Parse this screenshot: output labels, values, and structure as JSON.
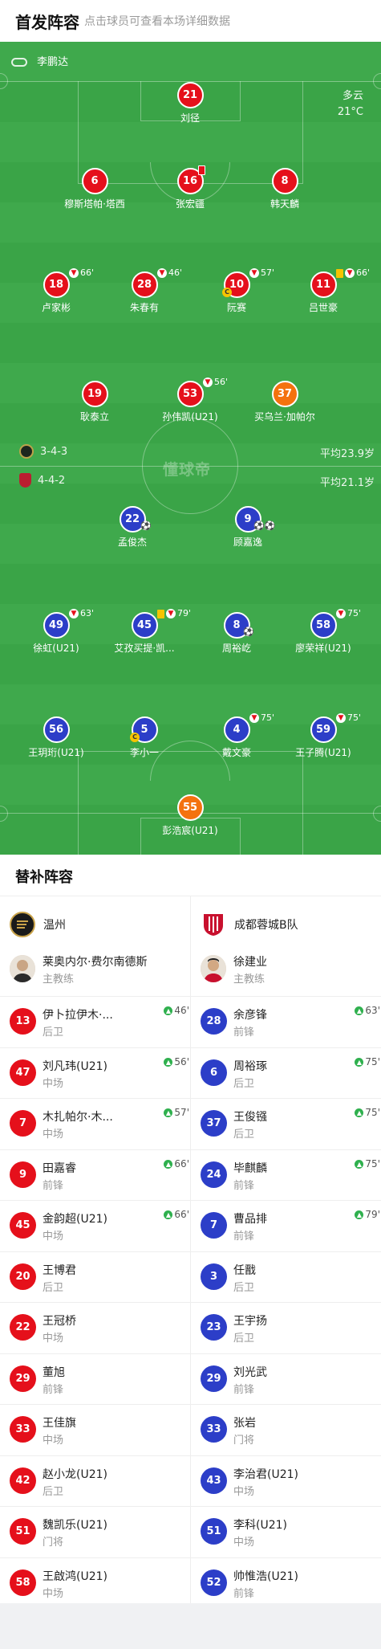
{
  "header": {
    "title": "首发阵容",
    "subtitle": "点击球员可查看本场详细数据"
  },
  "pitch": {
    "referee": "李鹏达",
    "weather": "多云",
    "temperature": "21°C",
    "watermark": "懂球帝",
    "home_formation": "3-4-3",
    "home_avg_age": "平均23.9岁",
    "away_formation": "4-4-2",
    "away_avg_age": "平均21.1岁",
    "home_players": [
      {
        "num": "21",
        "name": "刘径"
      },
      {
        "num": "6",
        "name": "穆斯塔帕·塔西"
      },
      {
        "num": "16",
        "name": "张宏疆"
      },
      {
        "num": "8",
        "name": "韩天麟"
      },
      {
        "num": "18",
        "name": "卢家彬",
        "sub": "66'"
      },
      {
        "num": "28",
        "name": "朱春有",
        "sub": "46'"
      },
      {
        "num": "10",
        "name": "阮赛",
        "sub": "57'"
      },
      {
        "num": "11",
        "name": "吕世豪",
        "sub": "66'"
      },
      {
        "num": "19",
        "name": "耿泰立"
      },
      {
        "num": "53",
        "name": "孙伟凯(U21)",
        "sub": "56'"
      },
      {
        "num": "37",
        "name": "买乌兰·加帕尔"
      }
    ],
    "away_players": [
      {
        "num": "22",
        "name": "孟俊杰"
      },
      {
        "num": "9",
        "name": "顾嘉逸"
      },
      {
        "num": "49",
        "name": "徐虹(U21)",
        "sub": "63'"
      },
      {
        "num": "45",
        "name": "艾孜买提·凯...",
        "sub": "79'"
      },
      {
        "num": "8",
        "name": "周裕屹"
      },
      {
        "num": "58",
        "name": "廖荣祥(U21)",
        "sub": "75'"
      },
      {
        "num": "56",
        "name": "王玥珩(U21)"
      },
      {
        "num": "5",
        "name": "李小一"
      },
      {
        "num": "4",
        "name": "戴文豪",
        "sub": "75'"
      },
      {
        "num": "59",
        "name": "王子腾(U21)",
        "sub": "75'"
      },
      {
        "num": "55",
        "name": "彭浩宸(U21)"
      }
    ]
  },
  "subs": {
    "title": "替补阵容",
    "home_team": "温州",
    "away_team": "成都蓉城B队",
    "home_coach": {
      "name": "莱奥内尔·费尔南德斯",
      "role": "主教练"
    },
    "away_coach": {
      "name": "徐建业",
      "role": "主教练"
    },
    "home": [
      {
        "num": "13",
        "name": "伊卜拉伊木·...",
        "pos": "后卫",
        "in": "46'"
      },
      {
        "num": "47",
        "name": "刘凡玮(U21)",
        "pos": "中场",
        "in": "56'"
      },
      {
        "num": "7",
        "name": "木扎帕尔·木...",
        "pos": "中场",
        "in": "57'"
      },
      {
        "num": "9",
        "name": "田嘉睿",
        "pos": "前锋",
        "in": "66'"
      },
      {
        "num": "45",
        "name": "金韵超(U21)",
        "pos": "中场",
        "in": "66'"
      },
      {
        "num": "20",
        "name": "王博君",
        "pos": "后卫"
      },
      {
        "num": "22",
        "name": "王冠桥",
        "pos": "中场"
      },
      {
        "num": "29",
        "name": "董旭",
        "pos": "前锋"
      },
      {
        "num": "33",
        "name": "王佳旗",
        "pos": "中场"
      },
      {
        "num": "42",
        "name": "赵小龙(U21)",
        "pos": "后卫"
      },
      {
        "num": "51",
        "name": "魏凯乐(U21)",
        "pos": "门将"
      },
      {
        "num": "58",
        "name": "王啟鸿(U21)",
        "pos": "中场"
      }
    ],
    "away": [
      {
        "num": "28",
        "name": "余彦锋",
        "pos": "前锋",
        "in": "63'"
      },
      {
        "num": "6",
        "name": "周裕琢",
        "pos": "后卫",
        "in": "75'"
      },
      {
        "num": "37",
        "name": "王俊镪",
        "pos": "后卫",
        "in": "75'"
      },
      {
        "num": "24",
        "name": "毕麒麟",
        "pos": "前锋",
        "in": "75'"
      },
      {
        "num": "7",
        "name": "曹品排",
        "pos": "前锋",
        "in": "79'"
      },
      {
        "num": "3",
        "name": "任戬",
        "pos": "后卫"
      },
      {
        "num": "23",
        "name": "王宇扬",
        "pos": "后卫"
      },
      {
        "num": "29",
        "name": "刘光武",
        "pos": "前锋"
      },
      {
        "num": "33",
        "name": "张岩",
        "pos": "门将"
      },
      {
        "num": "43",
        "name": "李治君(U21)",
        "pos": "中场"
      },
      {
        "num": "51",
        "name": "李科(U21)",
        "pos": "中场"
      },
      {
        "num": "52",
        "name": "帅惟浩(U21)",
        "pos": "前锋"
      }
    ]
  },
  "colors": {
    "home": "#e5101b",
    "away": "#2c3ec8",
    "keeper": "#f4720e",
    "pitch": "#3aa447"
  }
}
